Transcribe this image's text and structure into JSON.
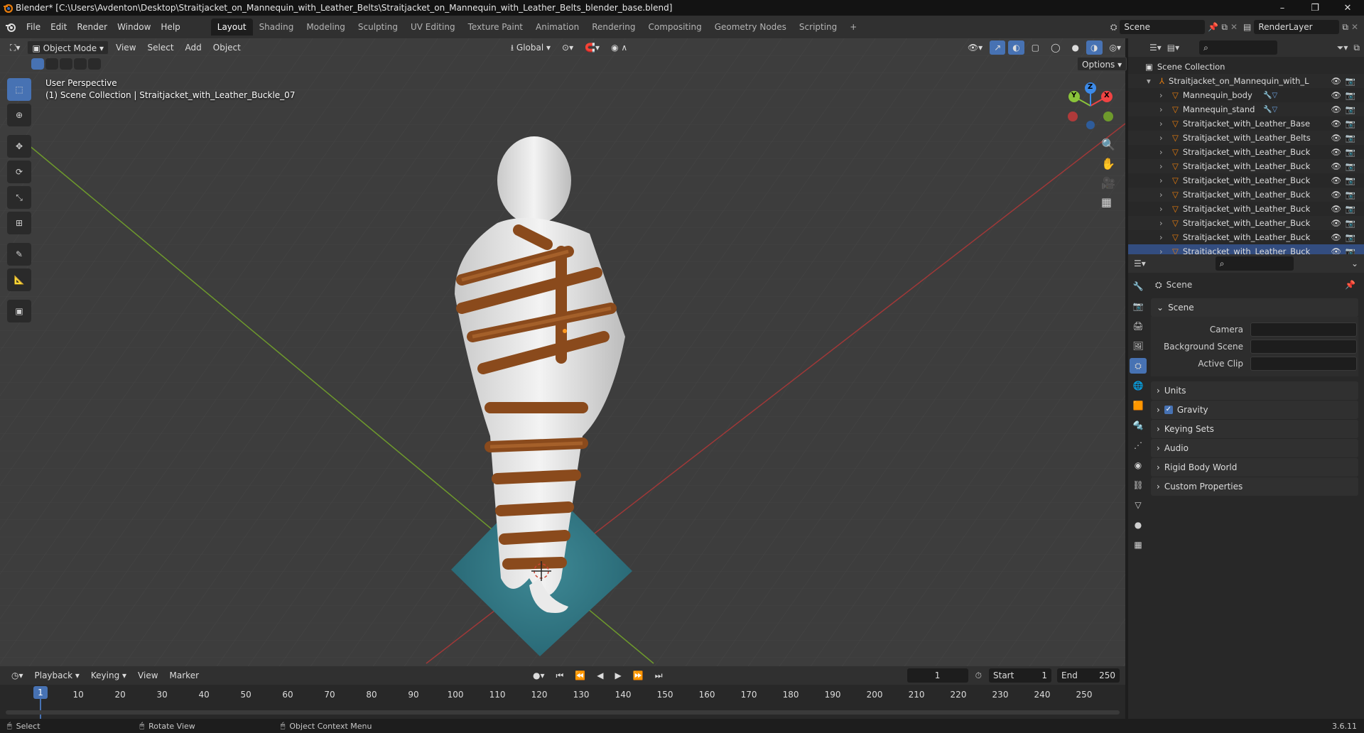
{
  "window": {
    "title": "Blender* [C:\\Users\\Avdenton\\Desktop\\Straitjacket_on_Mannequin_with_Leather_Belts\\Straitjacket_on_Mannequin_with_Leather_Belts_blender_base.blend]",
    "minimize": "–",
    "maximize": "❐",
    "close": "✕"
  },
  "menu": [
    "File",
    "Edit",
    "Render",
    "Window",
    "Help"
  ],
  "workspaces": [
    "Layout",
    "Shading",
    "Modeling",
    "Sculpting",
    "UV Editing",
    "Texture Paint",
    "Animation",
    "Rendering",
    "Compositing",
    "Geometry Nodes",
    "Scripting",
    "+"
  ],
  "active_workspace": "Layout",
  "scene_field": "Scene",
  "viewlayer_field": "RenderLayer",
  "viewport_header": {
    "mode": "Object Mode",
    "view": "View",
    "select": "Select",
    "add": "Add",
    "object": "Object",
    "orientation": "Global",
    "options": "Options"
  },
  "viewport_overlay": {
    "line1": "User Perspective",
    "line2": "(1) Scene Collection | Straitjacket_with_Leather_Buckle_07"
  },
  "gizmo": {
    "x": "X",
    "y": "Y",
    "z": "Z"
  },
  "outliner": {
    "root": "Scene Collection",
    "collection": "Straitjacket_on_Mannequin_with_Leathe",
    "items": [
      "Mannequin_body",
      "Mannequin_stand",
      "Straitjacket_with_Leather_Base",
      "Straitjacket_with_Leather_Belts",
      "Straitjacket_with_Leather_Buckle_C",
      "Straitjacket_with_Leather_Buckle_C",
      "Straitjacket_with_Leather_Buckle_C",
      "Straitjacket_with_Leather_Buckle_C",
      "Straitjacket_with_Leather_Buckle_C",
      "Straitjacket_with_Leather_Buckle_C",
      "Straitjacket_with_Leather_Buckle_C",
      "Straitjacket_with_Leather_Buckle_C"
    ]
  },
  "properties": {
    "context": "Scene",
    "panel": "Scene",
    "camera_label": "Camera",
    "background_label": "Background Scene",
    "clip_label": "Active Clip",
    "sections": [
      "Units",
      "Gravity",
      "Keying Sets",
      "Audio",
      "Rigid Body World",
      "Custom Properties"
    ]
  },
  "timeline": {
    "playback": "Playback",
    "keying": "Keying",
    "view": "View",
    "marker": "Marker",
    "current_frame": "1",
    "start_label": "Start",
    "start": "1",
    "end_label": "End",
    "end": "250",
    "ticks": [
      "1",
      "10",
      "20",
      "30",
      "40",
      "50",
      "60",
      "70",
      "80",
      "90",
      "100",
      "110",
      "120",
      "130",
      "140",
      "150",
      "160",
      "170",
      "180",
      "190",
      "200",
      "210",
      "220",
      "230",
      "240",
      "250"
    ]
  },
  "status": {
    "select": "Select",
    "rotate": "Rotate View",
    "context": "Object Context Menu",
    "version": "3.6.11"
  },
  "colors": {
    "accent": "#4772b3",
    "blender_orange": "#e87d0d",
    "axis_x": "#f04343",
    "axis_y": "#8ac43a",
    "axis_z": "#3c8ae8"
  }
}
